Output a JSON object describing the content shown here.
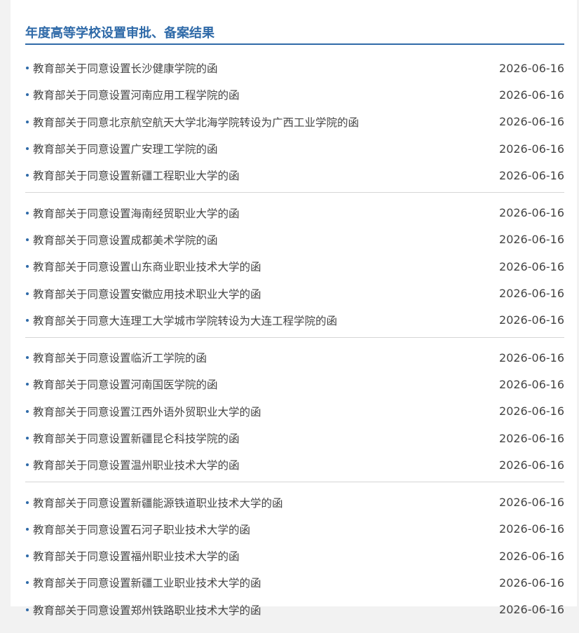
{
  "section": {
    "title": "年度高等学校设置审批、备案结果"
  },
  "groups": [
    [
      {
        "title": "教育部关于同意设置长沙健康学院的函",
        "date": "2026-06-16"
      },
      {
        "title": "教育部关于同意设置河南应用工程学院的函",
        "date": "2026-06-16"
      },
      {
        "title": "教育部关于同意北京航空航天大学北海学院转设为广西工业学院的函",
        "date": "2026-06-16"
      },
      {
        "title": "教育部关于同意设置广安理工学院的函",
        "date": "2026-06-16"
      },
      {
        "title": "教育部关于同意设置新疆工程职业大学的函",
        "date": "2026-06-16"
      }
    ],
    [
      {
        "title": "教育部关于同意设置海南经贸职业大学的函",
        "date": "2026-06-16"
      },
      {
        "title": "教育部关于同意设置成都美术学院的函",
        "date": "2026-06-16"
      },
      {
        "title": "教育部关于同意设置山东商业职业技术大学的函",
        "date": "2026-06-16"
      },
      {
        "title": "教育部关于同意设置安徽应用技术职业大学的函",
        "date": "2026-06-16"
      },
      {
        "title": "教育部关于同意大连理工大学城市学院转设为大连工程学院的函",
        "date": "2026-06-16"
      }
    ],
    [
      {
        "title": "教育部关于同意设置临沂工学院的函",
        "date": "2026-06-16"
      },
      {
        "title": "教育部关于同意设置河南国医学院的函",
        "date": "2026-06-16"
      },
      {
        "title": "教育部关于同意设置江西外语外贸职业大学的函",
        "date": "2026-06-16"
      },
      {
        "title": "教育部关于同意设置新疆昆仑科技学院的函",
        "date": "2026-06-16"
      },
      {
        "title": "教育部关于同意设置温州职业技术大学的函",
        "date": "2026-06-16"
      }
    ],
    [
      {
        "title": "教育部关于同意设置新疆能源铁道职业技术大学的函",
        "date": "2026-06-16"
      },
      {
        "title": "教育部关于同意设置石河子职业技术大学的函",
        "date": "2026-06-16"
      },
      {
        "title": "教育部关于同意设置福州职业技术大学的函",
        "date": "2026-06-16"
      },
      {
        "title": "教育部关于同意设置新疆工业职业技术大学的函",
        "date": "2026-06-16"
      },
      {
        "title": "教育部关于同意设置郑州铁路职业技术大学的函",
        "date": "2026-06-16"
      }
    ]
  ],
  "colors": {
    "accent": "#2f6aa8",
    "text": "#444444",
    "divider": "#d6d6d6",
    "background": "#f2f2f2"
  },
  "icons": {
    "bullet": "bullet-dot-icon"
  }
}
